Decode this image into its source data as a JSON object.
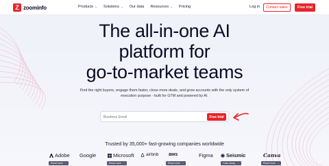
{
  "nav": {
    "logo_text": "zoominfo",
    "logo_mark": "Z",
    "menu": [
      {
        "label": "Products",
        "has_chevron": true
      },
      {
        "label": "Solutions",
        "has_chevron": true
      },
      {
        "label": "Our data",
        "has_chevron": false
      },
      {
        "label": "Resources",
        "has_chevron": true
      },
      {
        "label": "Pricing",
        "has_chevron": false
      }
    ],
    "login": "Log in",
    "contact_sales": "Contact sales",
    "free_trial": "Free trial"
  },
  "hero": {
    "headline_lines": [
      "The all-in-one AI",
      "platform for",
      "go-to-market teams"
    ],
    "subtext": "Find the right buyers, engage them faster, close more deals, and grow accounts with the only system of execution purpose - built for GTM and powered by AI.",
    "email_placeholder": "Business Email",
    "email_button": "Free trial"
  },
  "trusted": {
    "text": "Trusted by 35,000+ fast-growing companies worldwide",
    "logos": [
      {
        "name": "Adobe",
        "icon": "adobe-icon",
        "read_more": "Read more"
      },
      {
        "name": "Google",
        "icon": null,
        "read_more": null
      },
      {
        "name": "Microsoft",
        "icon": "microsoft-icon",
        "read_more": "Read more"
      },
      {
        "name": "airbnb",
        "icon": "airbnb-icon",
        "read_more": null
      },
      {
        "name": "aws",
        "icon": null,
        "read_more": "Read more"
      },
      {
        "name": "Figma",
        "icon": null,
        "read_more": null
      },
      {
        "name": "Seismic",
        "icon": "seismic-icon",
        "read_more": "Case study"
      },
      {
        "name": "Canva",
        "icon": null,
        "read_more": "Read more"
      }
    ]
  },
  "colors": {
    "brand_red": "#e8242a",
    "headline": "#0b0b24",
    "background": "#eef1f9"
  }
}
